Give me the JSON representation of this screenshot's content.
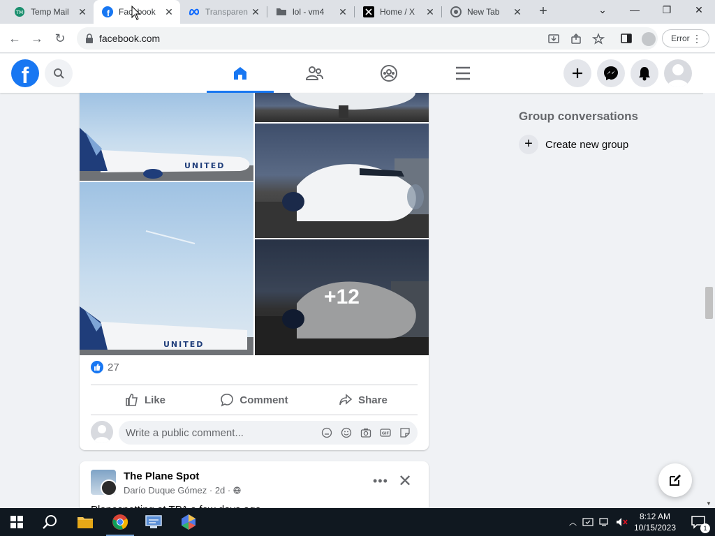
{
  "browser": {
    "tabs": [
      {
        "title": "Temp Mail",
        "icon": "tempmail-icon",
        "active": false
      },
      {
        "title": "Facebook",
        "icon": "facebook-icon",
        "active": true
      },
      {
        "title": "Transparen",
        "icon": "meta-icon",
        "active": false
      },
      {
        "title": "lol - vm4",
        "icon": "folder-icon",
        "active": false
      },
      {
        "title": "Home / X",
        "icon": "x-icon",
        "active": false
      },
      {
        "title": "New Tab",
        "icon": "chrome-icon",
        "active": false
      }
    ],
    "url": "facebook.com",
    "profile_error_label": "Error"
  },
  "facebook": {
    "logo_letter": "f",
    "photo_more_count": "+12",
    "reaction_count": "27",
    "actions": {
      "like": "Like",
      "comment": "Comment",
      "share": "Share"
    },
    "comment_placeholder": "Write a public comment...",
    "group_conversations_title": "Group conversations",
    "create_group_label": "Create new group",
    "next_post": {
      "page_name": "The Plane Spot",
      "author": "Darío Duque Gómez",
      "age": "2d",
      "separator": "·",
      "text_preview": "Planespotting at TPA a few days ago"
    },
    "brand_color": "#1877f2"
  },
  "taskbar": {
    "time": "8:12 AM",
    "date": "10/15/2023",
    "notification_count": "1"
  }
}
